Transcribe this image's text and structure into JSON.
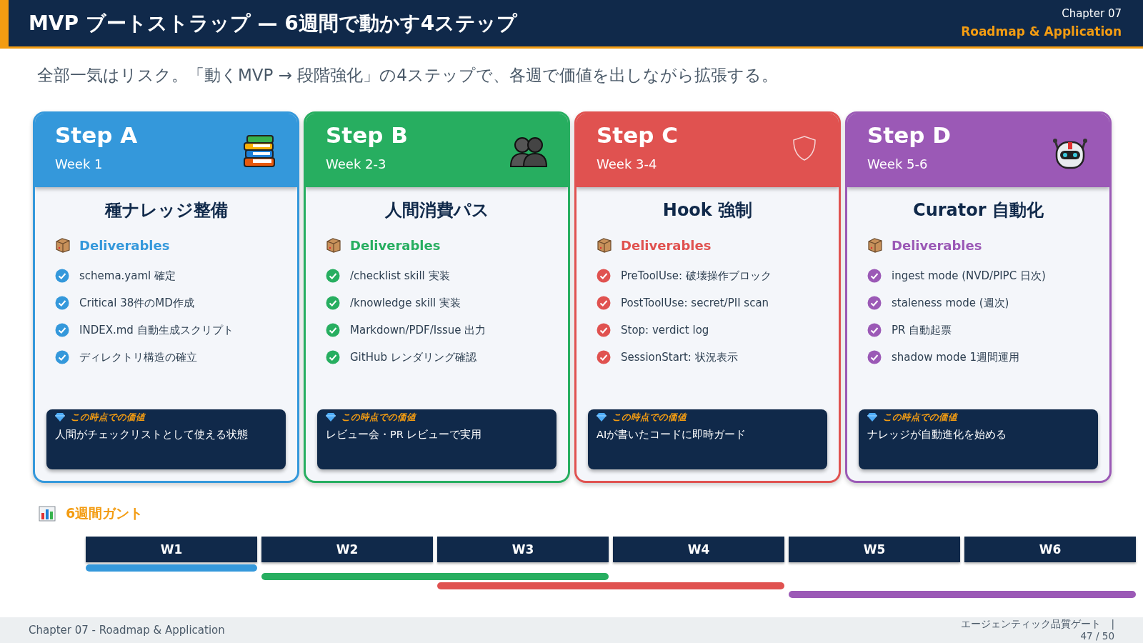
{
  "header": {
    "title": "MVP ブートストラップ — 6週間で動かす4ステップ",
    "chapter": "Chapter 07",
    "section": "Roadmap & Application"
  },
  "subtitle": "全部一気はリスク。「動くMVP → 段階強化」の4ステップで、各週で価値を出しながら拡張する。",
  "steps": [
    {
      "title": "Step A",
      "week": "Week 1",
      "color": "#3498db",
      "heading": "種ナレッジ整備",
      "deliverables_label": "Deliverables",
      "items": [
        "schema.yaml 確定",
        "Critical 38件のMD作成",
        "INDEX.md 自動生成スクリプト",
        "ディレクトリ構造の確立"
      ],
      "value_label": "この時点での価値",
      "value": "人間がチェックリストとして使える状態"
    },
    {
      "title": "Step B",
      "week": "Week 2-3",
      "color": "#27ae60",
      "heading": "人間消費パス",
      "deliverables_label": "Deliverables",
      "items": [
        "/checklist skill 実装",
        "/knowledge skill 実装",
        "Markdown/PDF/Issue 出力",
        "GitHub レンダリング確認"
      ],
      "value_label": "この時点での価値",
      "value": "レビュー会・PR レビューで実用"
    },
    {
      "title": "Step C",
      "week": "Week 3-4",
      "color": "#e05250",
      "heading": "Hook 強制",
      "deliverables_label": "Deliverables",
      "items": [
        "PreToolUse: 破壊操作ブロック",
        "PostToolUse: secret/PII scan",
        "Stop: verdict log",
        "SessionStart: 状況表示"
      ],
      "value_label": "この時点での価値",
      "value": "AIが書いたコードに即時ガード"
    },
    {
      "title": "Step D",
      "week": "Week 5-6",
      "color": "#9b59b6",
      "heading": "Curator 自動化",
      "deliverables_label": "Deliverables",
      "items": [
        "ingest mode (NVD/PIPC 日次)",
        "staleness mode (週次)",
        "PR 自動起票",
        "shadow mode 1週間運用"
      ],
      "value_label": "この時点での価値",
      "value": "ナレッジが自動進化を始める"
    }
  ],
  "gantt": {
    "title": "6週間ガント",
    "weeks": [
      "W1",
      "W2",
      "W3",
      "W4",
      "W5",
      "W6"
    ],
    "bars": [
      {
        "color": "#3498db",
        "weeks": [
          true,
          false,
          false,
          false,
          false,
          false
        ]
      },
      {
        "color": "#27ae60",
        "weeks": [
          false,
          true,
          true,
          false,
          false,
          false
        ]
      },
      {
        "color": "#e05250",
        "weeks": [
          false,
          false,
          true,
          true,
          false,
          false
        ]
      },
      {
        "color": "#9b59b6",
        "weeks": [
          false,
          false,
          false,
          false,
          true,
          true
        ]
      }
    ]
  },
  "footer": {
    "left": "Chapter 07 - Roadmap & Application",
    "right": "エージェンティック品質ゲート　|",
    "page": "47 / 50"
  }
}
